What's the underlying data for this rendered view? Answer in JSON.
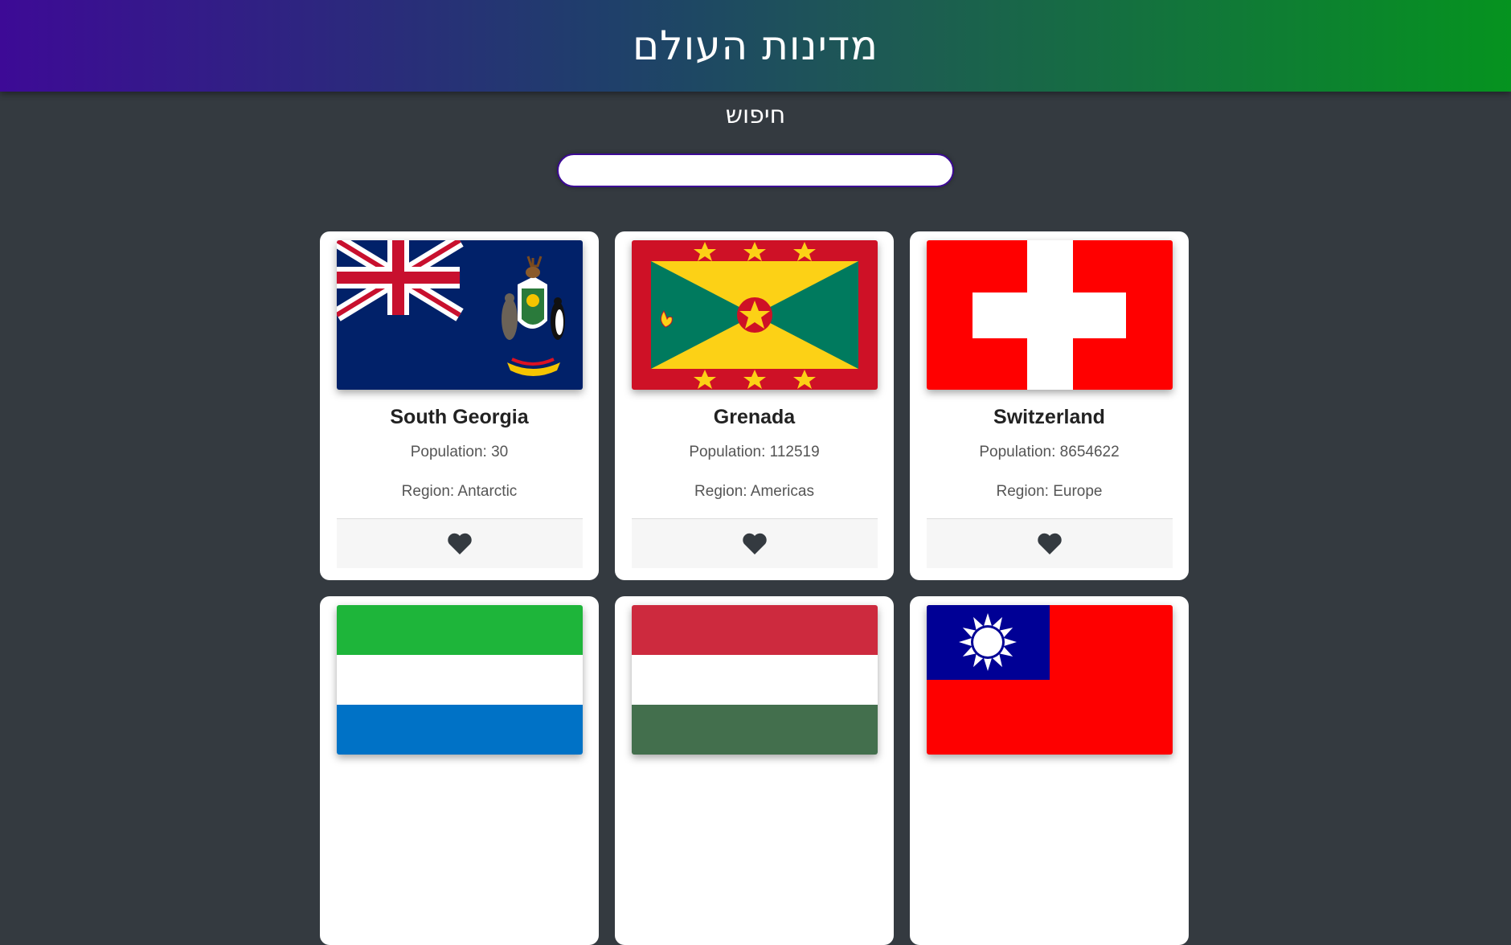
{
  "header": {
    "title": "מדינות העולם"
  },
  "search": {
    "label": "חיפוש",
    "value": ""
  },
  "countries": [
    {
      "name": "South Georgia",
      "population": "Population: 30",
      "region": "Region: Antarctic",
      "flag": "south-georgia-flag"
    },
    {
      "name": "Grenada",
      "population": "Population: 112519",
      "region": "Region: Americas",
      "flag": "grenada-flag"
    },
    {
      "name": "Switzerland",
      "population": "Population: 8654622",
      "region": "Region: Europe",
      "flag": "switzerland-flag"
    },
    {
      "name": "",
      "population": "",
      "region": "",
      "flag": "sierra-leone-flag"
    },
    {
      "name": "",
      "population": "",
      "region": "",
      "flag": "hungary-flag"
    },
    {
      "name": "",
      "population": "",
      "region": "",
      "flag": "taiwan-flag"
    }
  ],
  "favorite_icon": "heart-icon",
  "colors": {
    "background": "#343a40",
    "header_start": "#3d0a96",
    "header_end": "#05931f"
  }
}
